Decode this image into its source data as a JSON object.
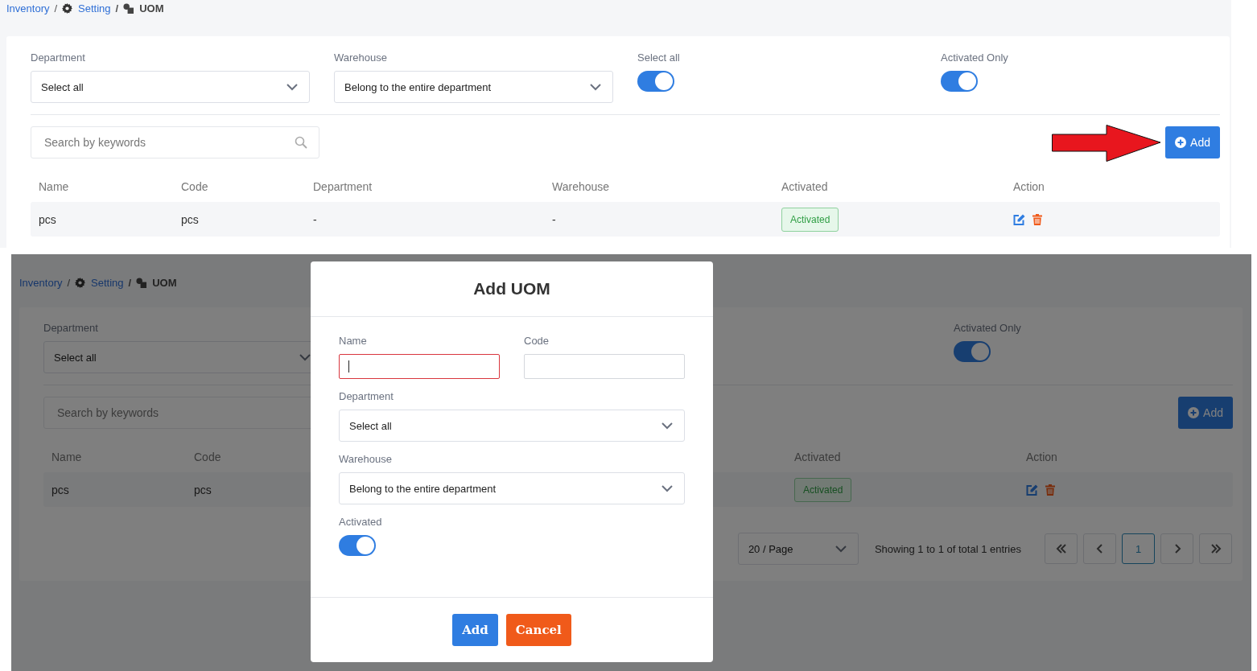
{
  "top_view": {
    "breadcrumb": [
      {
        "label": "Inventory",
        "kind": "root"
      },
      {
        "label": "Setting",
        "kind": "section",
        "separator": "/"
      },
      {
        "label": "UOM",
        "kind": "current",
        "separator": "/"
      }
    ],
    "filters": [
      {
        "label": "Department",
        "kind": "select",
        "value": "Select all"
      },
      {
        "label": "Warehouse",
        "kind": "select",
        "value": "Belong to the entire department"
      },
      {
        "label": "Select all",
        "kind": "toggle",
        "on": true
      },
      {
        "label": "Activated Only",
        "kind": "toggle",
        "on": true
      }
    ],
    "search": {
      "placeholder": "Search by keywords"
    },
    "add_button": {
      "label": "Add"
    },
    "table": {
      "columns": [
        "Name",
        "Code",
        "Department",
        "Warehouse",
        "Activated",
        "Action"
      ],
      "rows": [
        {
          "cells": [
            {
              "kind": "text",
              "text": "pcs"
            },
            {
              "kind": "text",
              "text": "pcs"
            },
            {
              "kind": "text",
              "text": "-"
            },
            {
              "kind": "text",
              "text": "-"
            },
            {
              "kind": "badge",
              "text": "Activated"
            },
            {
              "kind": "actions"
            }
          ]
        }
      ]
    }
  },
  "bottom_view": {
    "breadcrumb": [
      {
        "label": "Inventory",
        "kind": "root"
      },
      {
        "label": "Setting",
        "kind": "section",
        "separator": "/"
      },
      {
        "label": "UOM",
        "kind": "current",
        "separator": "/"
      }
    ],
    "filters": [
      {
        "label": "Department",
        "kind": "select",
        "value": "Select all"
      },
      {
        "label": "Activated Only",
        "kind": "toggle",
        "on": true
      }
    ],
    "search": {
      "placeholder": "Search by keywords"
    },
    "add_button": {
      "label": "Add"
    },
    "table": {
      "columns": [
        "Name",
        "Code",
        "Activated",
        "Action"
      ],
      "rows": [
        {
          "cells": [
            {
              "kind": "text",
              "text": "pcs"
            },
            {
              "kind": "text",
              "text": "pcs"
            },
            {
              "kind": "badge",
              "text": "Activated"
            },
            {
              "kind": "actions"
            }
          ]
        }
      ]
    },
    "pagination": {
      "per_page": "20 / Page",
      "summary": "Showing 1 to 1 of total 1 entries",
      "pages": [
        {
          "label": "1",
          "selected": true
        }
      ]
    },
    "modal": {
      "title": "Add UOM",
      "fields": [
        {
          "label": "Name",
          "kind": "input",
          "invalid": true
        },
        {
          "label": "Code",
          "kind": "input",
          "invalid": false
        },
        {
          "label": "Department",
          "kind": "select",
          "value": "Select all"
        },
        {
          "label": "Warehouse",
          "kind": "select",
          "value": "Belong to the entire department"
        },
        {
          "label": "Activated",
          "kind": "toggle",
          "on": true
        }
      ],
      "buttons": [
        {
          "label": "Add",
          "kind": "primary"
        },
        {
          "label": "Cancel",
          "kind": "danger"
        }
      ]
    }
  }
}
